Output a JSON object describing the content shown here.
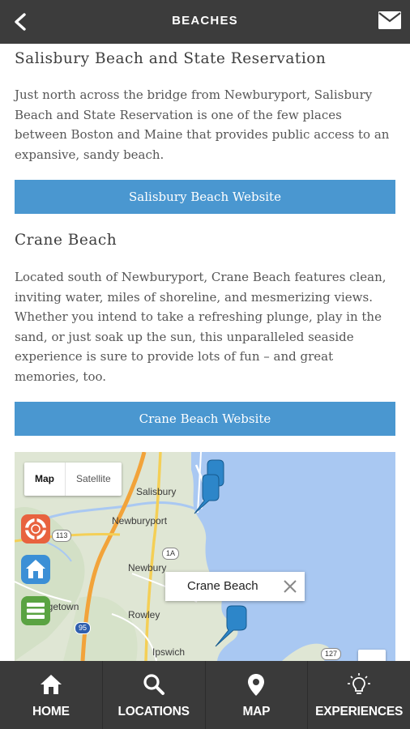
{
  "header": {
    "title": "BEACHES",
    "back_icon": "back-arrow-icon",
    "mail_icon": "mail-icon"
  },
  "beaches": [
    {
      "title": "Salisbury Beach and State Reservation",
      "description": "Just north across the bridge from Newburyport, Salisbury Beach and State Reservation is one of the few places between Boston and Maine that provides public access to an expansive, sandy beach.",
      "button_label": "Salisbury Beach Website"
    },
    {
      "title": "Crane Beach",
      "description": "Located south of Newburyport, Crane Beach features clean, inviting water, miles of shoreline, and mesmerizing views. Whether you intend to take a refreshing plunge, play in the sand, or just soak up the sun, this unparalleled seaside experience is sure to provide lots of fun – and great memories, too.",
      "button_label": "Crane Beach Website"
    }
  ],
  "map": {
    "type_options": [
      "Map",
      "Satellite"
    ],
    "selected_type": "Map",
    "towns": [
      "Salisbury",
      "Newburyport",
      "Newbury",
      "Rowley",
      "Ipswich",
      "orgetown"
    ],
    "route_shields": [
      "113",
      "1A",
      "95",
      "127"
    ],
    "callout_text": "Crane Beach",
    "side_buttons": [
      "lifebuoy-icon",
      "home-icon",
      "list-icon"
    ]
  },
  "tabs": [
    {
      "label": "HOME",
      "icon": "home-icon"
    },
    {
      "label": "LOCATIONS",
      "icon": "search-icon"
    },
    {
      "label": "MAP",
      "icon": "map-pin-icon"
    },
    {
      "label": "EXPERIENCES",
      "icon": "lightbulb-icon"
    }
  ],
  "colors": {
    "header_bg": "#3c3c3c",
    "button_blue": "#4a97d0",
    "tabbar_bg": "#3a3a3a",
    "map_water": "#a9c8f2",
    "marker_blue": "#2d86c9"
  }
}
